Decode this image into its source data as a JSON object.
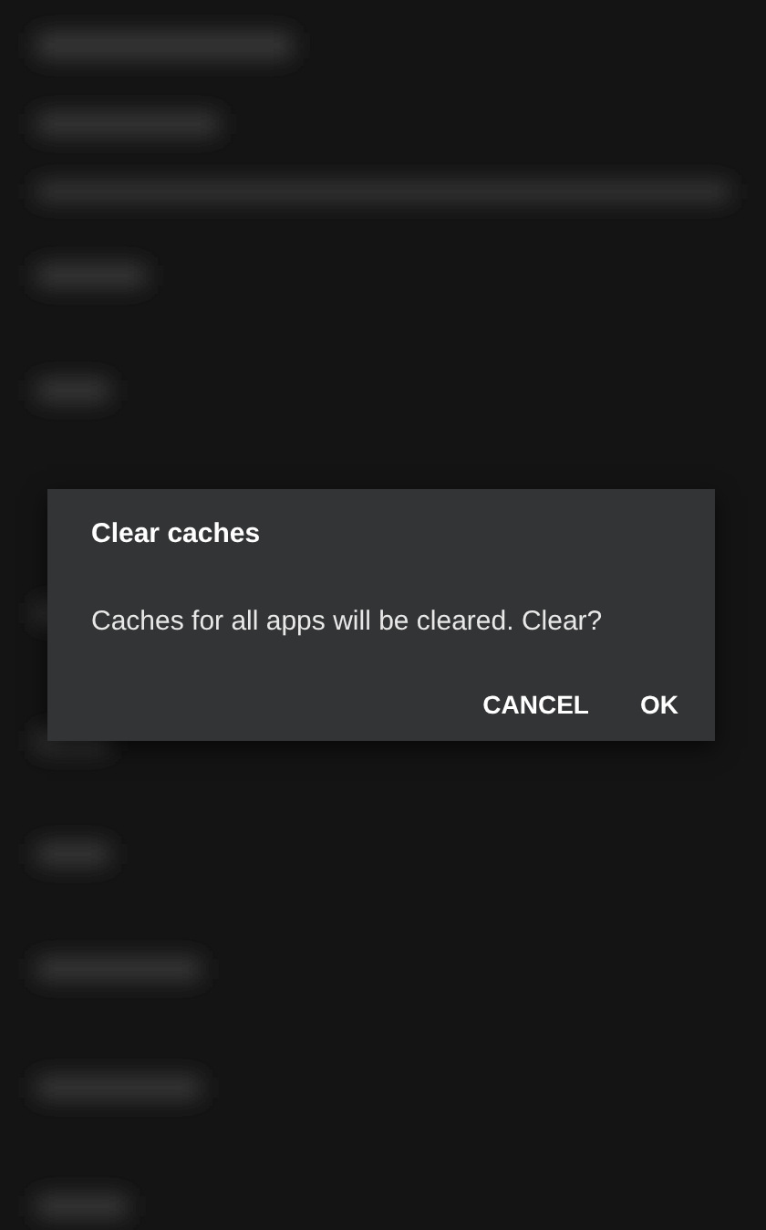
{
  "dialog": {
    "title": "Clear caches",
    "message": "Caches for all apps will be cleared. Clear?",
    "buttons": [
      {
        "label": "CANCEL"
      },
      {
        "label": "OK"
      }
    ]
  }
}
